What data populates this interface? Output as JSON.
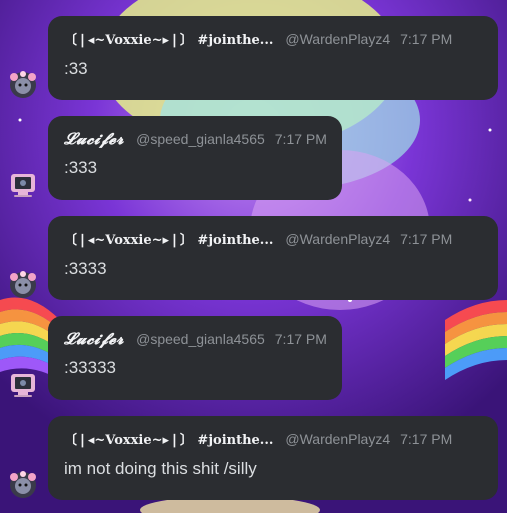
{
  "colors": {
    "bubble": "#2b2d31",
    "username": "#f2f3f5",
    "meta": "#8e9297",
    "text": "#dbdee1",
    "background": "#5a1fb0"
  },
  "messages": [
    {
      "author": "〔❘◂~Voxxie~▸❘〕 #jointhe...",
      "handle": "@WardenPlayz4",
      "time": "7:17 PM",
      "content": ":33",
      "avatar": "flower-avatar-icon"
    },
    {
      "author": "𝓛𝓾𝓬𝓲𝓯𝓮𝓻",
      "handle": "@speed_gianla4565",
      "time": "7:17 PM",
      "content": ":333",
      "avatar": "computer-avatar-icon"
    },
    {
      "author": "〔❘◂~Voxxie~▸❘〕 #jointhe...",
      "handle": "@WardenPlayz4",
      "time": "7:17 PM",
      "content": ":3333",
      "avatar": "flower-avatar-icon"
    },
    {
      "author": "𝓛𝓾𝓬𝓲𝓯𝓮𝓻",
      "handle": "@speed_gianla4565",
      "time": "7:17 PM",
      "content": ":33333",
      "avatar": "computer-avatar-icon"
    },
    {
      "author": "〔❘◂~Voxxie~▸❘〕 #jointhe...",
      "handle": "@WardenPlayz4",
      "time": "7:17 PM",
      "content": "im not doing this shit /silly",
      "avatar": "flower-avatar-icon"
    }
  ]
}
